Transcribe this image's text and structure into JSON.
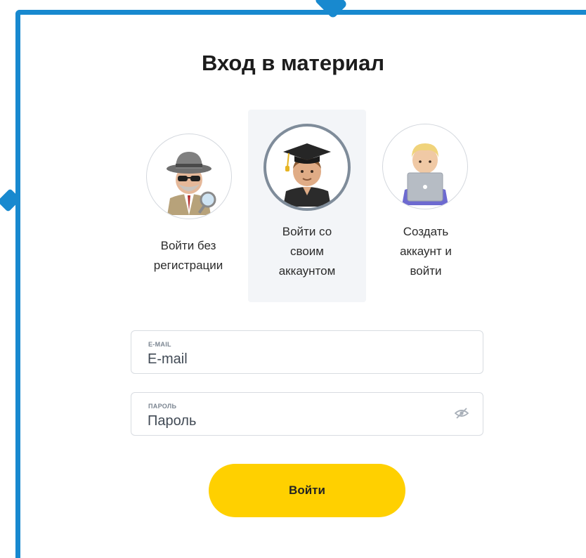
{
  "title": "Вход в материал",
  "options": [
    {
      "label": "Войти без\nрегистрации",
      "icon": "detective-icon",
      "selected": false
    },
    {
      "label": "Войти со\nсвоим\nаккаунтом",
      "icon": "student-icon",
      "selected": true
    },
    {
      "label": "Создать\nаккаунт и\nвойти",
      "icon": "technologist-icon",
      "selected": false
    }
  ],
  "email": {
    "small_label": "E-MAIL",
    "placeholder": "E-mail"
  },
  "password": {
    "small_label": "ПАРОЛЬ",
    "placeholder": "Пароль",
    "toggle_icon": "eye-off-icon"
  },
  "submit_label": "Войти",
  "colors": {
    "accent": "#ffd000",
    "frame": "#1889cf",
    "selected_bg": "#f3f5f8"
  }
}
